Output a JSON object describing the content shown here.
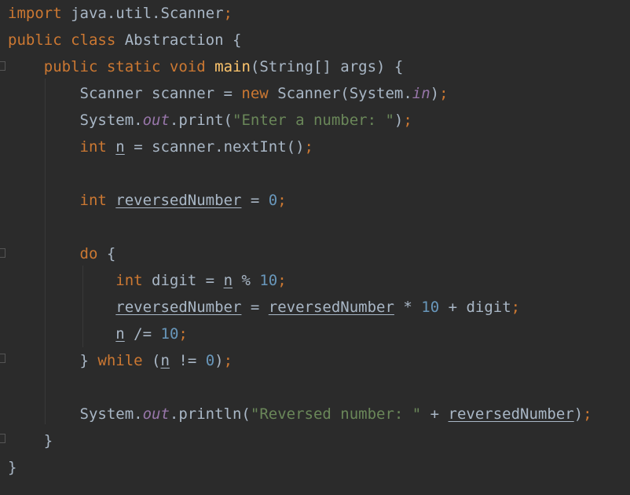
{
  "editor": {
    "lines": [
      {
        "indent": "",
        "tokens": [
          {
            "t": "import",
            "c": "kw"
          },
          {
            "t": " java.util.Scanner",
            "c": ""
          },
          {
            "t": ";",
            "c": "kw"
          }
        ]
      },
      {
        "indent": "",
        "tokens": [
          {
            "t": "public class",
            "c": "kw"
          },
          {
            "t": " Abstraction {",
            "c": ""
          }
        ]
      },
      {
        "indent": "    ",
        "tokens": [
          {
            "t": "public static void",
            "c": "kw"
          },
          {
            "t": " ",
            "c": ""
          },
          {
            "t": "main",
            "c": "fn"
          },
          {
            "t": "(String[] args) {",
            "c": ""
          }
        ]
      },
      {
        "indent": "        ",
        "tokens": [
          {
            "t": "Scanner scanner = ",
            "c": ""
          },
          {
            "t": "new",
            "c": "kw"
          },
          {
            "t": " Scanner(System.",
            "c": ""
          },
          {
            "t": "in",
            "c": "fld"
          },
          {
            "t": ")",
            "c": ""
          },
          {
            "t": ";",
            "c": "kw"
          }
        ]
      },
      {
        "indent": "        ",
        "tokens": [
          {
            "t": "System.",
            "c": ""
          },
          {
            "t": "out",
            "c": "fld"
          },
          {
            "t": ".print(",
            "c": ""
          },
          {
            "t": "\"Enter a number: \"",
            "c": "str"
          },
          {
            "t": ")",
            "c": ""
          },
          {
            "t": ";",
            "c": "kw"
          }
        ]
      },
      {
        "indent": "        ",
        "tokens": [
          {
            "t": "int",
            "c": "kw"
          },
          {
            "t": " ",
            "c": ""
          },
          {
            "t": "n",
            "c": "ul"
          },
          {
            "t": " = scanner.nextInt()",
            "c": ""
          },
          {
            "t": ";",
            "c": "kw"
          }
        ]
      },
      {
        "indent": "",
        "tokens": []
      },
      {
        "indent": "        ",
        "tokens": [
          {
            "t": "int",
            "c": "kw"
          },
          {
            "t": " ",
            "c": ""
          },
          {
            "t": "reversedNumber",
            "c": "ul"
          },
          {
            "t": " = ",
            "c": ""
          },
          {
            "t": "0",
            "c": "num"
          },
          {
            "t": ";",
            "c": "kw"
          }
        ]
      },
      {
        "indent": "",
        "tokens": []
      },
      {
        "indent": "        ",
        "tokens": [
          {
            "t": "do",
            "c": "kw"
          },
          {
            "t": " {",
            "c": ""
          }
        ]
      },
      {
        "indent": "            ",
        "tokens": [
          {
            "t": "int",
            "c": "kw"
          },
          {
            "t": " digit = ",
            "c": ""
          },
          {
            "t": "n",
            "c": "ul"
          },
          {
            "t": " % ",
            "c": ""
          },
          {
            "t": "10",
            "c": "num"
          },
          {
            "t": ";",
            "c": "kw"
          }
        ]
      },
      {
        "indent": "            ",
        "tokens": [
          {
            "t": "reversedNumber",
            "c": "ul"
          },
          {
            "t": " = ",
            "c": ""
          },
          {
            "t": "reversedNumber",
            "c": "ul"
          },
          {
            "t": " * ",
            "c": ""
          },
          {
            "t": "10",
            "c": "num"
          },
          {
            "t": " + digit",
            "c": ""
          },
          {
            "t": ";",
            "c": "kw"
          }
        ]
      },
      {
        "indent": "            ",
        "tokens": [
          {
            "t": "n",
            "c": "ul"
          },
          {
            "t": " /= ",
            "c": ""
          },
          {
            "t": "10",
            "c": "num"
          },
          {
            "t": ";",
            "c": "kw"
          }
        ]
      },
      {
        "indent": "        ",
        "tokens": [
          {
            "t": "} ",
            "c": ""
          },
          {
            "t": "while",
            "c": "kw"
          },
          {
            "t": " (",
            "c": ""
          },
          {
            "t": "n",
            "c": "ul"
          },
          {
            "t": " != ",
            "c": ""
          },
          {
            "t": "0",
            "c": "num"
          },
          {
            "t": ")",
            "c": ""
          },
          {
            "t": ";",
            "c": "kw"
          }
        ]
      },
      {
        "indent": "",
        "tokens": []
      },
      {
        "indent": "        ",
        "tokens": [
          {
            "t": "System.",
            "c": ""
          },
          {
            "t": "out",
            "c": "fld"
          },
          {
            "t": ".println(",
            "c": ""
          },
          {
            "t": "\"Reversed number: \"",
            "c": "str"
          },
          {
            "t": " + ",
            "c": ""
          },
          {
            "t": "reversedNumber",
            "c": "ul"
          },
          {
            "t": ")",
            "c": ""
          },
          {
            "t": ";",
            "c": "kw"
          }
        ]
      },
      {
        "indent": "    ",
        "tokens": [
          {
            "t": "}",
            "c": ""
          }
        ]
      },
      {
        "indent": "",
        "tokens": [
          {
            "t": "}",
            "c": ""
          }
        ]
      }
    ]
  },
  "colors": {
    "background": "#2b2b2b",
    "keyword": "#cc7832",
    "default": "#a9b7c6",
    "method": "#ffc66d",
    "string": "#6a8759",
    "number": "#6897bb",
    "static_field": "#9876aa"
  }
}
